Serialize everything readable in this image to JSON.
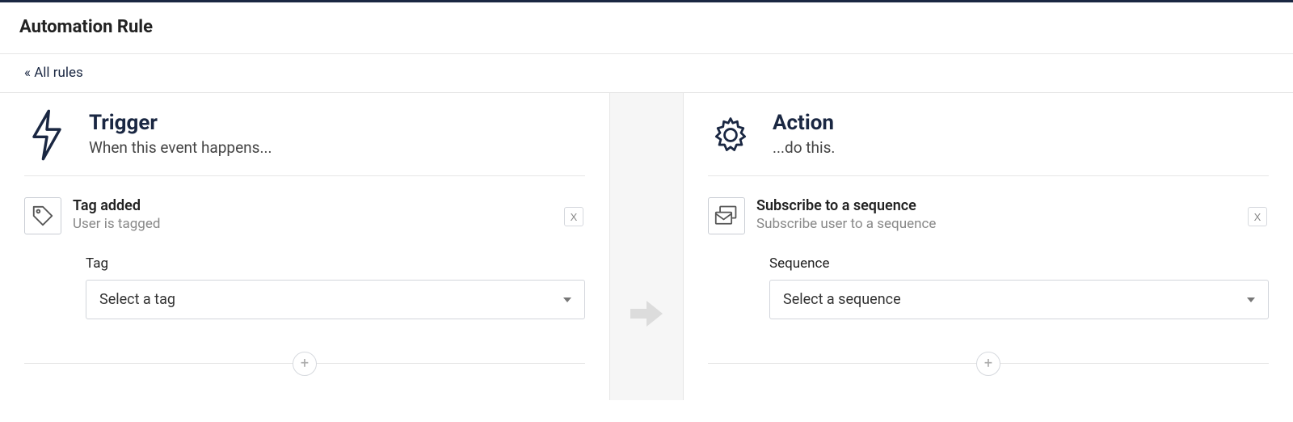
{
  "header": {
    "title": "Automation Rule"
  },
  "breadcrumb": {
    "back_label": "« All rules"
  },
  "trigger": {
    "title": "Trigger",
    "subtitle": "When this event happens...",
    "card": {
      "label": "Tag added",
      "sublabel": "User is tagged",
      "remove_label": "X"
    },
    "field": {
      "label": "Tag",
      "placeholder": "Select a tag"
    },
    "add_label": "+"
  },
  "action": {
    "title": "Action",
    "subtitle": "...do this.",
    "card": {
      "label": "Subscribe to a sequence",
      "sublabel": "Subscribe user to a sequence",
      "remove_label": "X"
    },
    "field": {
      "label": "Sequence",
      "placeholder": "Select a sequence"
    },
    "add_label": "+"
  }
}
